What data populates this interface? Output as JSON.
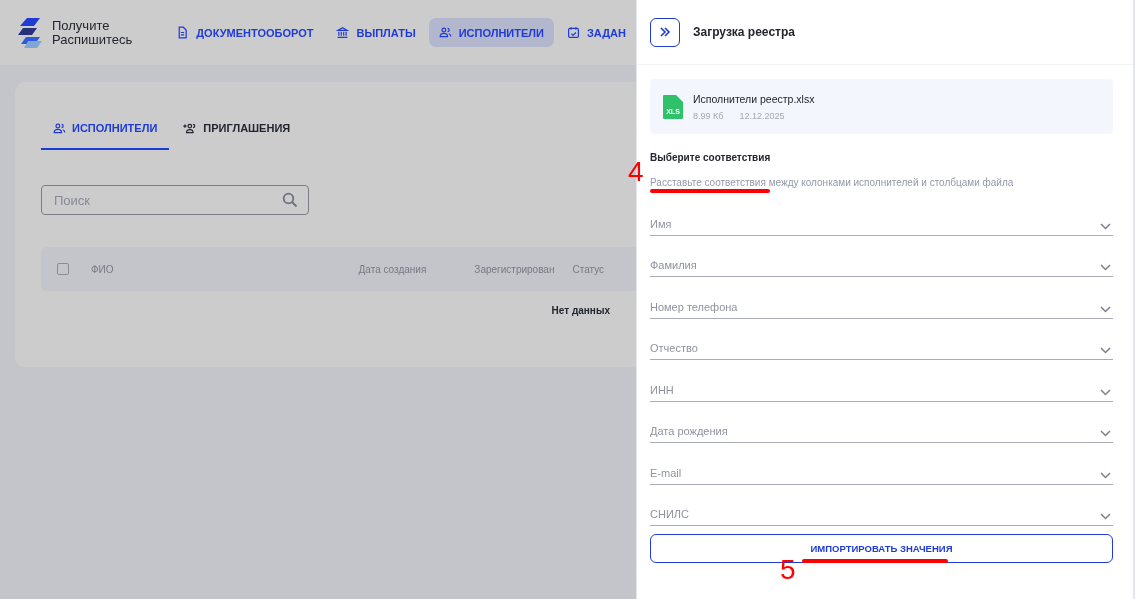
{
  "logo": {
    "line1": "Получите",
    "line2": "Распишитесь"
  },
  "nav": [
    {
      "label": "ДОКУМЕНТООБОРОТ",
      "selected": false
    },
    {
      "label": "ВЫПЛАТЫ",
      "selected": false
    },
    {
      "label": "ИСПОЛНИТЕЛИ",
      "selected": true
    },
    {
      "label": "ЗАДАН",
      "selected": false
    }
  ],
  "tabs": [
    {
      "label": "ИСПОЛНИТЕЛИ",
      "selected": true
    },
    {
      "label": "ПРИГЛАШЕНИЯ",
      "selected": false
    }
  ],
  "search": {
    "placeholder": "Поиск"
  },
  "table": {
    "select_all_checked": false,
    "columns": [
      "ФИО",
      "Дата создания",
      "Зарегистрирован",
      "Статус"
    ],
    "empty": "Нет данных"
  },
  "drawer": {
    "title": "Загрузка реестра",
    "file": {
      "name": "Исполнители реестр.xlsx",
      "size": "8.99 Кб",
      "date": "12.12.2025",
      "badge": "XLS"
    },
    "heading": "Выберите соответствия",
    "hint": "Расставьте соответствия между колонками исполнителей и столбцами файла",
    "fields": [
      {
        "placeholder": "Имя"
      },
      {
        "placeholder": "Фамилия"
      },
      {
        "placeholder": "Номер телефона"
      },
      {
        "placeholder": "Отчество"
      },
      {
        "placeholder": "ИНН"
      },
      {
        "placeholder": "Дата рождения"
      },
      {
        "placeholder": "E-mail"
      },
      {
        "placeholder": "СНИЛС"
      }
    ],
    "button": "ИМПОРТИРОВАТЬ ЗНАЧЕНИЯ"
  },
  "annotations": [
    {
      "number": "4"
    },
    {
      "number": "5"
    }
  ]
}
